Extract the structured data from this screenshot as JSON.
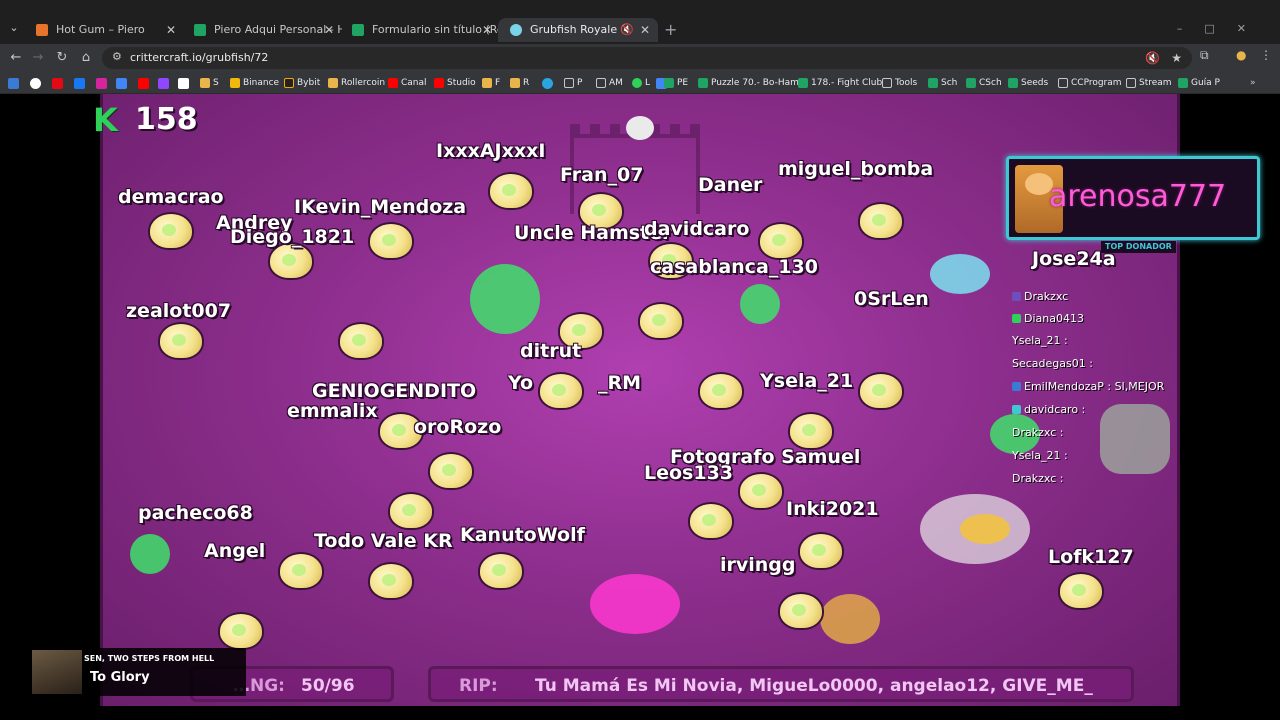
{
  "browser": {
    "tabs": [
      {
        "title": "Hot Gum – Piero",
        "active": false
      },
      {
        "title": "Piero Adqui Personal - Hojas de",
        "active": false
      },
      {
        "title": "Formulario sin título (Respuesta",
        "active": false
      },
      {
        "title": "Grubfish Royale",
        "active": true
      }
    ],
    "url": "crittercraft.io/grubfish/72",
    "bookmarks": [
      "S",
      "Binance",
      "Bybit",
      "Rollercoin",
      "Canal",
      "Studio",
      "F",
      "R",
      "P",
      "AM",
      "L",
      "PE",
      "Puzzle 70.- Bo-Ham...",
      "178.- Fight Club",
      "Tools",
      "Sch",
      "CSch",
      "Seeds",
      "CCProgram",
      "Stream",
      "Guía P"
    ]
  },
  "game": {
    "kills": "158",
    "top_donor": {
      "name": "arenosa777",
      "label": "TOP DONADOR"
    },
    "player_names": [
      "demacrao",
      "IxxxAJxxxI",
      "Fran_07",
      "Daner",
      "miguel_bomba",
      "Andrey",
      "Diego_1821",
      "IKevin_Mendoza",
      "Uncle Hamster",
      "davidcaro",
      "casablanca_130",
      "0SrLen",
      "Jose24a",
      "zealot007",
      "ditrut",
      "Yo",
      "_RM",
      "Ysela_21",
      "GENIOGENDITO",
      "emmalix",
      "oroRozo",
      "Fotografo Samuel",
      "Leos133",
      "Inki2021",
      "pacheco68",
      "Todo Vale KR",
      "KanutoWolf",
      "irvingg",
      "Lofk127",
      "Angel"
    ],
    "chat": [
      {
        "user": "Drakzxc",
        "text": ""
      },
      {
        "user": "Diana0413",
        "text": ""
      },
      {
        "user": "Ysela_21",
        "text": ""
      },
      {
        "user": "Secadegas01",
        "text": ""
      },
      {
        "user": "EmilMendozaP",
        "text": "SI,MEJOR"
      },
      {
        "user": "davidcaro",
        "text": ""
      },
      {
        "user": "Drakzxc",
        "text": ""
      },
      {
        "user": "Ysela_21",
        "text": ""
      },
      {
        "user": "Drakzxc",
        "text": ""
      }
    ],
    "remaining": {
      "label": "…NG:",
      "value": "50/96"
    },
    "rip": {
      "label": "RIP:",
      "value": "Tu Mamá Es Mi Novia, MigueLo0000, angelao12, GIVE_ME_"
    }
  },
  "music": {
    "artist": "SEN, TWO STEPS FROM HELL",
    "title": "To Glory"
  },
  "colors": {
    "arena": "#8d2e8d",
    "kill_k": "#2fd158",
    "donor_border": "#3fc8d4",
    "donor_name": "#ff5bd6"
  }
}
